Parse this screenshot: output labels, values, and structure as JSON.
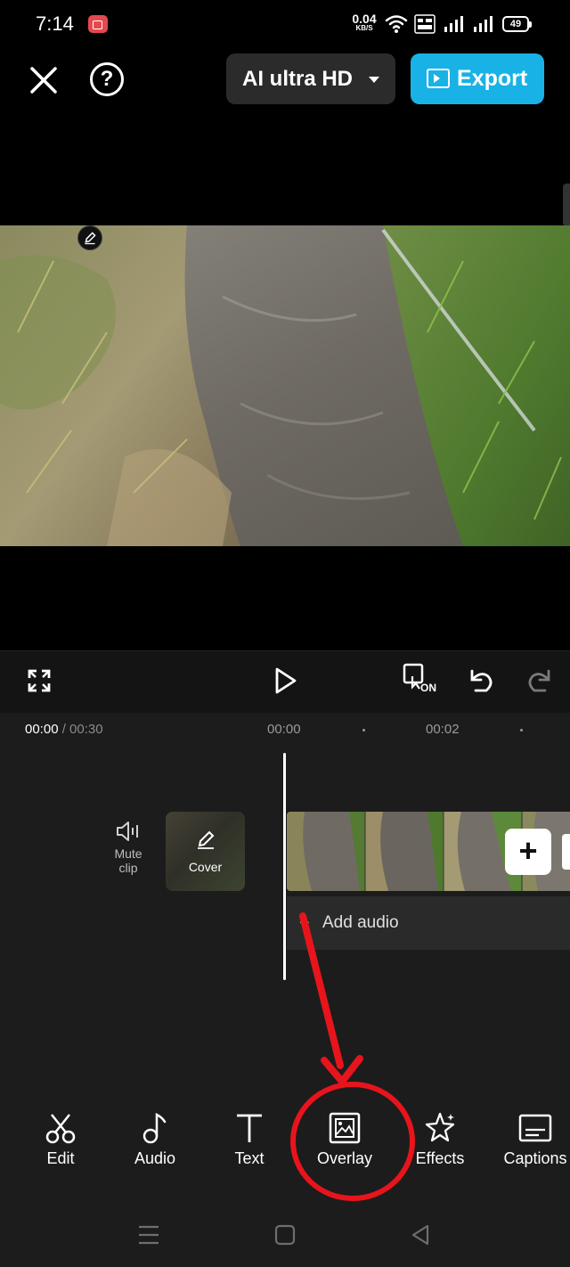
{
  "status_bar": {
    "time": "7:14",
    "net_speed_value": "0.04",
    "net_speed_unit": "KB/S",
    "battery": "49",
    "icons": [
      "screen-record-icon",
      "wifi-icon",
      "volte-icon",
      "signal-icon",
      "signal-icon",
      "battery-icon"
    ]
  },
  "top_bar": {
    "close_icon": "close-icon",
    "help_label": "?",
    "quality_label": "AI ultra HD",
    "export_label": "Export"
  },
  "controls": {
    "icons": [
      "fullscreen-icon",
      "play-icon",
      "keyframe-on-icon",
      "undo-icon",
      "redo-icon"
    ],
    "keyframe_badge": "ON"
  },
  "timeline": {
    "current_time": "00:00",
    "total_time": " / 00:30",
    "ruler": [
      "00:00",
      "00:02"
    ],
    "mute_clip_label": "Mute clip",
    "cover_label": "Cover",
    "add_clip_label": "+",
    "add_audio_label": "Add audio",
    "add_audio_plus": "+"
  },
  "tools": [
    {
      "label": "Edit",
      "icon": "scissors-icon"
    },
    {
      "label": "Audio",
      "icon": "music-note-icon"
    },
    {
      "label": "Text",
      "icon": "text-icon"
    },
    {
      "label": "Overlay",
      "icon": "overlay-icon"
    },
    {
      "label": "Effects",
      "icon": "effects-star-icon"
    },
    {
      "label": "Captions",
      "icon": "captions-icon"
    }
  ],
  "annotation": {
    "highlight_color": "#e8141c",
    "target": "Overlay"
  },
  "colors": {
    "accent": "#19b2e6",
    "background": "#000000",
    "panel": "#1c1c1c"
  }
}
